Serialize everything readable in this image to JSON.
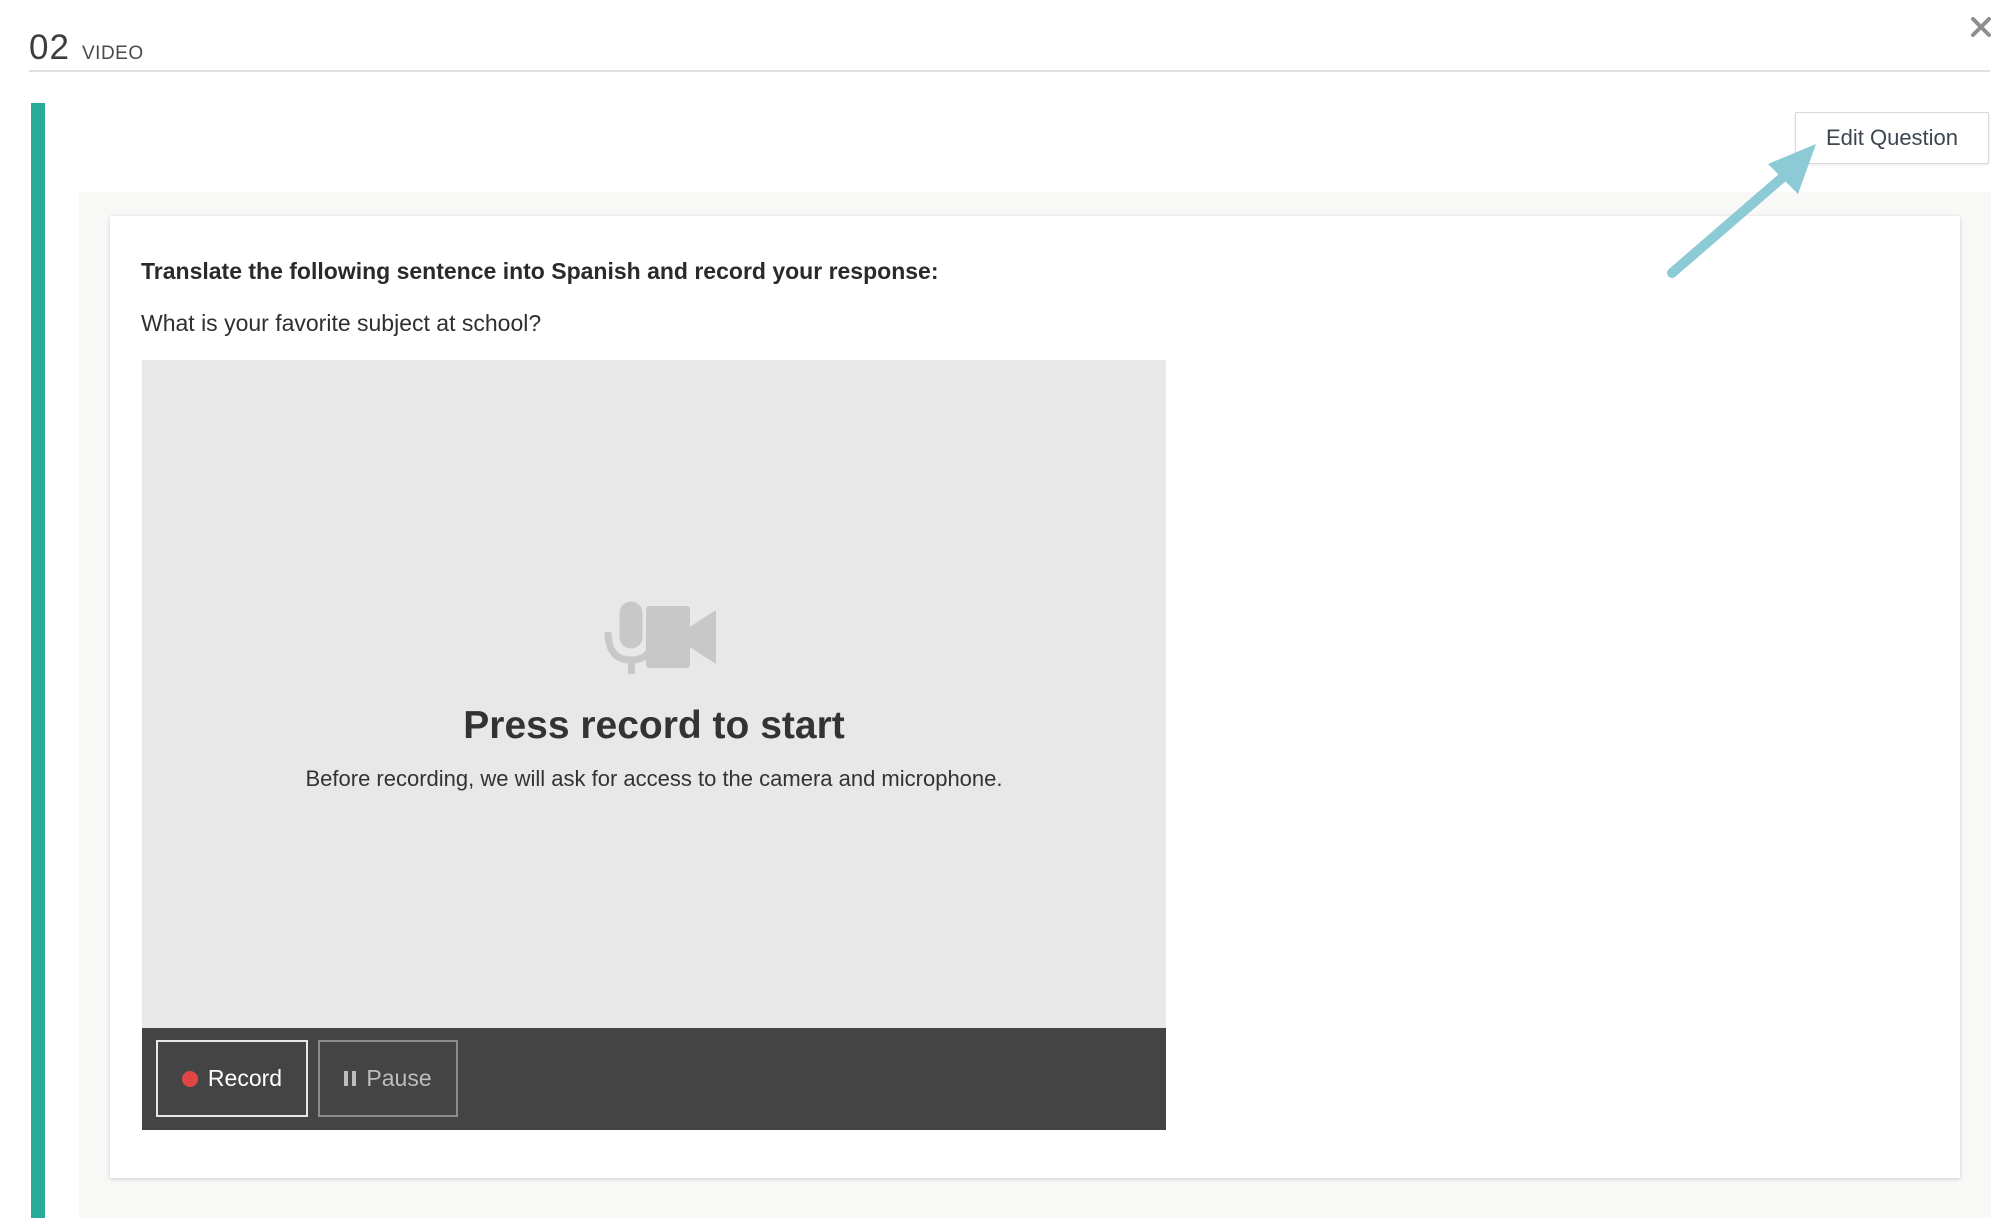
{
  "header": {
    "question_number": "02",
    "question_type": "VIDEO",
    "close_icon": "close-icon"
  },
  "toolbar": {
    "edit_question_label": "Edit Question"
  },
  "question": {
    "instruction": "Translate the following sentence into Spanish and record your response:",
    "sentence": "What is your favorite subject at school?"
  },
  "recorder": {
    "icon": "mic-camera-icon",
    "title": "Press record to start",
    "subtitle": "Before recording, we will ask for access to the camera and microphone.",
    "record_label": "Record",
    "pause_label": "Pause"
  },
  "colors": {
    "accent_bar": "#27ab98",
    "annotation_arrow": "#8ccad6",
    "record_dot": "#e04646",
    "controls_bg": "#444444"
  }
}
